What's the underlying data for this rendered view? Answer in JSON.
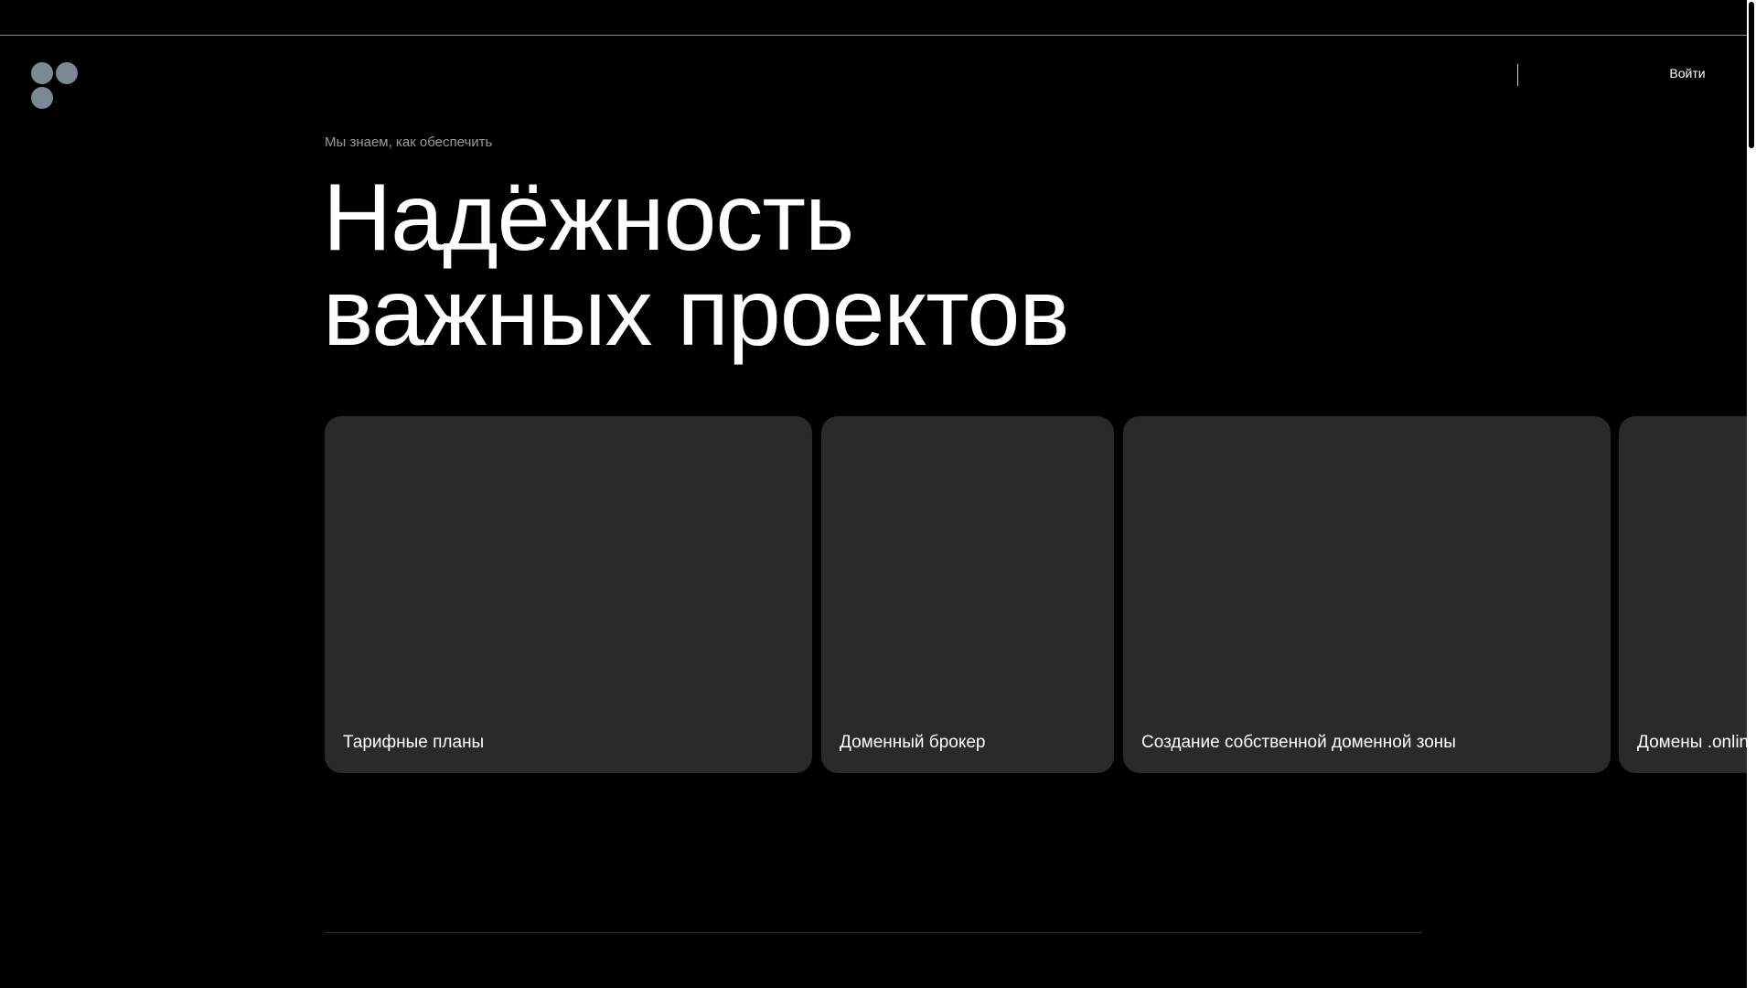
{
  "header": {
    "login_label": "Войти"
  },
  "hero": {
    "eyebrow": "Мы знаем, как обеспечить",
    "title_line1": "Надёжность",
    "title_line2": "важных проектов"
  },
  "cards": [
    {
      "label": "Тарифные планы"
    },
    {
      "label": "Доменный брокер"
    },
    {
      "label": "Создание собственной доменной зоны"
    },
    {
      "label": "Домены .online"
    }
  ],
  "colors": {
    "background": "#000000",
    "card_background": "#292a2a",
    "logo_dots": "#7b8a92",
    "text_primary": "#ffffff",
    "text_secondary": "#9a9a9a"
  }
}
